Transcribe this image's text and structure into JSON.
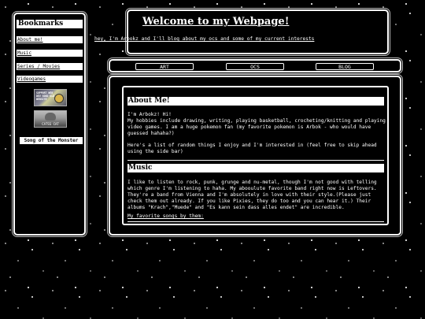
{
  "sidebar": {
    "title": "Bookmarks",
    "items": [
      {
        "label": "About me!"
      },
      {
        "label": "Music"
      },
      {
        "label": "Series / Movies"
      },
      {
        "label": "Videogames"
      }
    ],
    "badge1_text": "SUPPORT WEB DEV GOOD OLD WEBSITE",
    "badge2_text": "CATSS CAT",
    "song_label": "Song of the Monster"
  },
  "header": {
    "title": "Welcome to my Webpage!",
    "subtitle": "hey, I'm Arbokz and I'll blog about my ocs and some of my current interests"
  },
  "tabs": [
    {
      "label": "ART"
    },
    {
      "label": "OCS"
    },
    {
      "label": "BLOG"
    }
  ],
  "about": {
    "heading": "About Me!",
    "p1": "I'm Arbokz! Hi!\nMy hobbies include drawing, writing, playing basketball, crocheting/knitting and playing video games. I am a huge pokemon fan (my favorite pokemon is Arbok - who would have guessed hahaha?)",
    "p2": "Here's a list of random things I enjoy and I'm interested in (feel free to skip ahead using the side bar)"
  },
  "music": {
    "heading": "Music",
    "p1": "I like to listen to rock, punk, grunge and nu-metal, though I'm not good with telling which genre I'm listening to haha. My abooulute favorite band right now is Leftovers. They're a band from Vienna and I'm absolutely in love with their style.(Please just check them out already. If you like Pixies, they do too and you can hear it.) Their albums \"Krach\",\"Muede\" and \"Es kann sein dass alles endet\" are incredible.",
    "link": "My favorite songs by them:"
  },
  "colors": {
    "background": "#000000",
    "foreground": "#ffffff"
  }
}
